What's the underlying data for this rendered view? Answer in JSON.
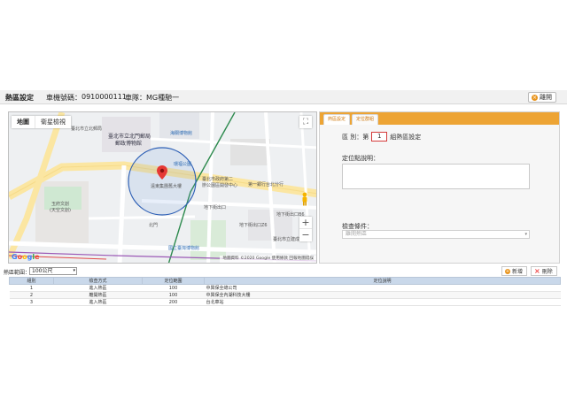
{
  "header": {
    "title": "熱區設定",
    "device_label": "車機號碼：",
    "device_number": "0910000111",
    "team_label": "車隊：",
    "team_name": "MG種馳一",
    "leave_button": "離開"
  },
  "map": {
    "type_buttons": [
      "地圖",
      "衛星檢視"
    ],
    "labels": {
      "museum": "臺北市立北門郵局",
      "museum2": "郵政博物館",
      "haiba": "海關博物館",
      "park": "環福公園",
      "marker_name": "遠東集團舊大樓",
      "station_mrt": "臺北市政府第二",
      "station_mrt2": "辦公園區開發中心",
      "bank": "第一銀行台北分行",
      "bldg": "玉府文創",
      "bldg2": "(天空文創)",
      "xinyi_rd": "忠孝西路",
      "beimen": "北門",
      "taipei_museum": "國立臺灣博物館",
      "xuchang": "許昌街",
      "hangzhou": "杭州南路",
      "yanping": "延平南路",
      "north_station": "臺北市立北郵局",
      "underground1": "地下街出口",
      "underground2": "地下街出口Z6",
      "underground3": "地下街出口B6",
      "nanyang": "南陽街",
      "pingan": "重慶南路",
      "kaifeng": "開封街",
      "xinbei": "懷寧街",
      "exit_m": "B2",
      "hotel": "臺北市立建成國中",
      "zhongxiao": "忠孝西路"
    },
    "logo_letters": [
      "G",
      "o",
      "o",
      "g",
      "l",
      "e"
    ],
    "attribution": "地圖資料 ©2020 Google   使用條款   回報地圖錯誤",
    "zoom_in": "+",
    "zoom_out": "−",
    "fullscreen_icon": "fullscreen-icon"
  },
  "panel": {
    "tabs": [
      "熱區設定",
      "定位群組"
    ],
    "zone_label": "區 別：第",
    "zone_number": "1",
    "zone_suffix": "組熱區設定",
    "desc_label": "定位點說明：",
    "cond_label": "檢查條件：",
    "cond_value": "離開熱區",
    "accent_color": "#eda434"
  },
  "toolbar": {
    "range_label": "熱區範圍：",
    "range_value": "100公尺",
    "add_button": "新增",
    "delete_button": "刪除"
  },
  "table": {
    "headers": [
      "組別",
      "檢查方式",
      "定位範圍",
      "定位說明"
    ],
    "rows": [
      [
        "1",
        "進入熱區",
        "100",
        "中興保全總公司"
      ],
      [
        "2",
        "離開熱區",
        "100",
        "中興保全內湖科技大樓"
      ],
      [
        "3",
        "進入熱區",
        "200",
        "台北車站"
      ]
    ]
  }
}
